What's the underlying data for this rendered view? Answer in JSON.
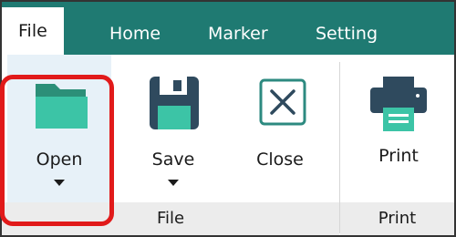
{
  "tabs": [
    {
      "label": "File",
      "active": true
    },
    {
      "label": "Home",
      "active": false
    },
    {
      "label": "Marker",
      "active": false
    },
    {
      "label": "Setting",
      "active": false
    }
  ],
  "ribbon": {
    "file_group": {
      "label": "File",
      "buttons": {
        "open": {
          "label": "Open",
          "icon": "folder-icon",
          "has_dropdown": true
        },
        "save": {
          "label": "Save",
          "icon": "save-icon",
          "has_dropdown": true
        },
        "close": {
          "label": "Close",
          "icon": "close-icon",
          "has_dropdown": false
        }
      }
    },
    "print_group": {
      "label": "Print",
      "buttons": {
        "print": {
          "label": "Print",
          "icon": "printer-icon",
          "has_dropdown": false
        }
      }
    }
  },
  "colors": {
    "tabbar": "#1f7a72",
    "accent": "#3cc4a6",
    "icon_dark": "#2f4a5e",
    "highlight": "#e11a1a"
  }
}
